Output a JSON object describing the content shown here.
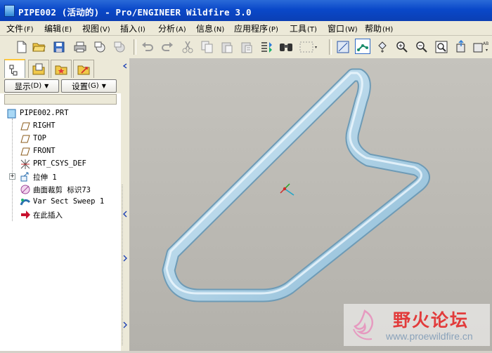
{
  "window": {
    "title": "PIPE002 (活动的) - Pro/ENGINEER Wildfire 3.0",
    "title_color": "#0a48c9"
  },
  "menubar": {
    "items": [
      {
        "label": "文件",
        "key": "(F)"
      },
      {
        "label": "编辑",
        "key": "(E)"
      },
      {
        "label": "视图",
        "key": "(V)"
      },
      {
        "label": "插入",
        "key": "(I)"
      },
      {
        "label": "分析",
        "key": "(A)"
      },
      {
        "label": "信息",
        "key": "(N)"
      },
      {
        "label": "应用程序",
        "key": "(P)"
      },
      {
        "label": "工具",
        "key": "(T)"
      },
      {
        "label": "窗口",
        "key": "(W)"
      },
      {
        "label": "帮助",
        "key": "(H)"
      }
    ]
  },
  "toolbar": {
    "icons": [
      "new-icon",
      "open-icon",
      "save-icon",
      "print-icon",
      "send-icon",
      "send-disabled-icon",
      "undo-icon",
      "redo-icon",
      "cut-icon",
      "copy-icon",
      "paste-icon",
      "paste-special-icon",
      "regenerate-icon",
      "find-icon",
      "select-box-icon",
      "datum-planes-icon",
      "datum-axes-icon",
      "datum-csys-icon",
      "zoom-in-icon",
      "zoom-out-icon",
      "refit-icon",
      "orient-icon",
      "view-list-icon"
    ]
  },
  "panel": {
    "show_label": "显示",
    "show_key": "(D)",
    "settings_label": "设置",
    "settings_key": "(G)"
  },
  "tree": {
    "root": "PIPE002.PRT",
    "items": [
      {
        "label": "RIGHT",
        "icon": "datum-plane-icon"
      },
      {
        "label": "TOP",
        "icon": "datum-plane-icon"
      },
      {
        "label": "FRONT",
        "icon": "datum-plane-icon"
      },
      {
        "label": "PRT_CSYS_DEF",
        "icon": "csys-icon"
      },
      {
        "label": "拉伸 1",
        "icon": "extrude-icon"
      },
      {
        "label": "曲面裁剪 标识73",
        "icon": "surface-trim-icon"
      },
      {
        "label": "Var Sect Sweep 1",
        "icon": "sweep-icon"
      },
      {
        "label": "在此插入",
        "icon": "insert-here-icon"
      }
    ]
  },
  "viewport": {
    "background": "#bebcb6",
    "pipe_color": "#aed3e8"
  },
  "watermark": {
    "text": "野火论坛",
    "url": "www.proewildfire.cn"
  }
}
